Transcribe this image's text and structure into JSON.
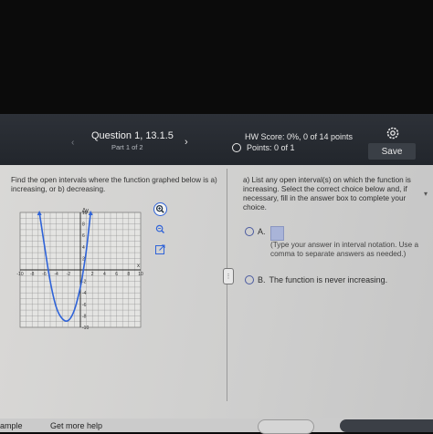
{
  "header": {
    "prev_arrow": "‹",
    "next_arrow": "›",
    "question_title": "Question 1, 13.1.5",
    "part": "Part 1 of 2",
    "hw_score": "HW Score: 0%, 0 of 14 points",
    "points": "Points: 0 of 1",
    "save_label": "Save"
  },
  "left_panel": {
    "prompt": "Find the open intervals where the function graphed below is a) increasing, or b) decreasing.",
    "graph": {
      "x_axis_label": "x",
      "y_axis_label": "Δy",
      "x_ticks": [
        "-10",
        "-8",
        "-6",
        "-4",
        "-2",
        "2",
        "4",
        "6",
        "8",
        "10"
      ],
      "y_ticks": [
        "10",
        "8",
        "6",
        "4",
        "2",
        "-2",
        "-4",
        "-6",
        "-8",
        "-10"
      ],
      "xlim": [
        -10,
        10
      ],
      "ylim": [
        -10,
        10
      ],
      "curve_color": "#2f63d8",
      "curve_points": [
        [
          -6.8,
          10
        ],
        [
          -6,
          4.5
        ],
        [
          -5,
          -2
        ],
        [
          -4,
          -6.5
        ],
        [
          -3,
          -8.5
        ],
        [
          -2,
          -8.8
        ],
        [
          -1,
          -7
        ],
        [
          0,
          -3
        ],
        [
          0.5,
          0
        ],
        [
          1,
          3.5
        ],
        [
          1.7,
          10
        ]
      ]
    },
    "tools": [
      "zoom-in-icon",
      "zoom-out-icon",
      "popout-icon"
    ]
  },
  "right_panel": {
    "question": "a) List any open interval(s) on which the function is increasing. Select the correct choice below and, if necessary, fill in the answer box to complete your choice.",
    "option_a_label": "A.",
    "option_a_hint": "(Type your answer in interval notation. Use a comma to separate answers as needed.)",
    "option_b_label": "B.",
    "option_b_text": "The function is never increasing."
  },
  "footer": {
    "left_text": "ample",
    "mid_text": "Get more help"
  },
  "colors": {
    "header_bg": "#2a2e34",
    "content_bg": "#d4d4d2",
    "accent": "#2f63d8"
  }
}
